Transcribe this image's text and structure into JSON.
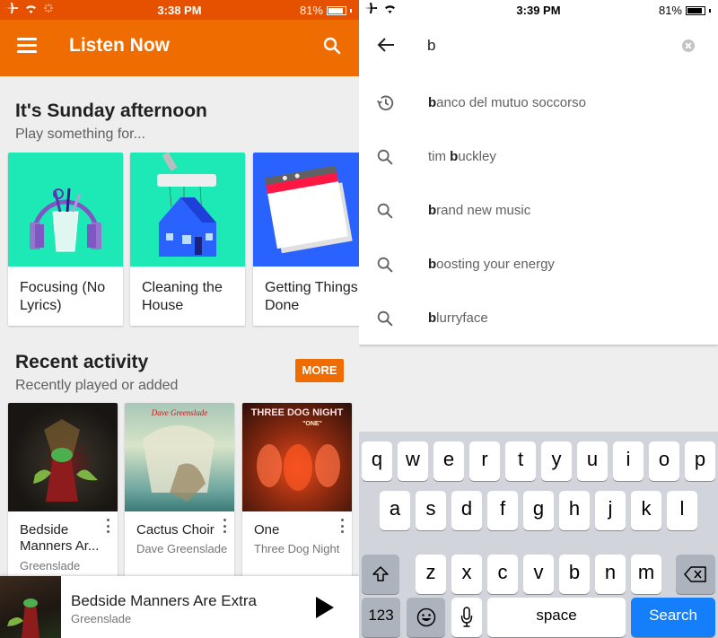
{
  "left_screen": {
    "status_bar": {
      "time": "3:38 PM",
      "battery": "81%"
    },
    "app_bar": {
      "title": "Listen Now",
      "menu_icon": "hamburger-icon",
      "search_icon": "search-icon"
    },
    "suggestion_section": {
      "title": "It's Sunday afternoon",
      "subtitle": "Play something for...",
      "cards": [
        {
          "label": "Focusing (No Lyrics)",
          "art": "headphones-pencil-cup",
          "bg_color": "#1de9b6"
        },
        {
          "label": "Cleaning the House",
          "art": "vacuum-house",
          "bg_color": "#1de9b6"
        },
        {
          "label": "Getting Things Done",
          "art": "notepad-calendar",
          "bg_color": "#2962ff"
        }
      ]
    },
    "recent_section": {
      "title": "Recent activity",
      "subtitle": "Recently played or added",
      "more_label": "MORE",
      "items": [
        {
          "title": "Bedside Manners Ar...",
          "artist": "Greenslade",
          "cover_text": ""
        },
        {
          "title": "Cactus Choir",
          "artist": "Dave Greenslade",
          "cover_text": "Dave Greenslade"
        },
        {
          "title": "One",
          "artist": "Three Dog Night",
          "cover_text": "THREE DOG NIGHT",
          "cover_subtext": "\"ONE\""
        }
      ]
    },
    "now_playing": {
      "title": "Bedside Manners Are Extra",
      "artist": "Greenslade",
      "play_icon": "play-icon"
    }
  },
  "right_screen": {
    "status_bar": {
      "time": "3:39 PM",
      "battery": "81%"
    },
    "search": {
      "query": "b",
      "back_icon": "arrow-back-icon",
      "clear_icon": "clear-icon"
    },
    "suggestions": [
      {
        "type": "history",
        "prefix": "",
        "bold": "b",
        "rest": "anco del mutuo soccorso"
      },
      {
        "type": "search",
        "prefix": "tim ",
        "bold": "b",
        "rest": "uckley"
      },
      {
        "type": "search",
        "prefix": "",
        "bold": "b",
        "rest": "rand new music"
      },
      {
        "type": "search",
        "prefix": "",
        "bold": "b",
        "rest": "oosting your energy"
      },
      {
        "type": "search",
        "prefix": "",
        "bold": "b",
        "rest": "lurryface"
      }
    ],
    "keyboard": {
      "row1": [
        "q",
        "w",
        "e",
        "r",
        "t",
        "y",
        "u",
        "i",
        "o",
        "p"
      ],
      "row2": [
        "a",
        "s",
        "d",
        "f",
        "g",
        "h",
        "j",
        "k",
        "l"
      ],
      "row3": [
        "z",
        "x",
        "c",
        "v",
        "b",
        "n",
        "m"
      ],
      "numbers_label": "123",
      "space_label": "space",
      "search_label": "Search"
    }
  },
  "colors": {
    "accent": "#ef6c00",
    "status_orange": "#e65100",
    "keyboard_blue": "#147efb"
  }
}
